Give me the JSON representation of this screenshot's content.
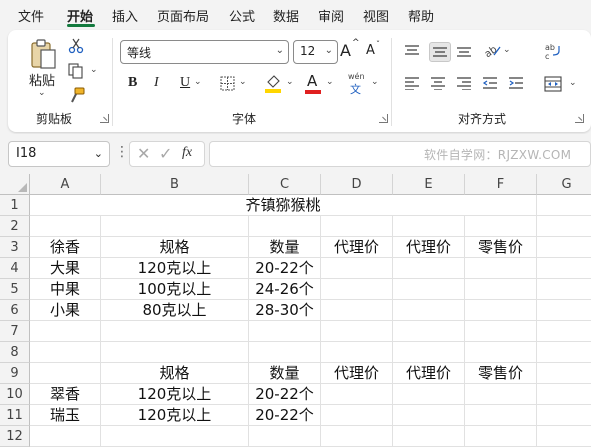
{
  "menu": {
    "tabs": [
      {
        "label": "文件"
      },
      {
        "label": "开始"
      },
      {
        "label": "插入"
      },
      {
        "label": "页面布局"
      },
      {
        "label": "公式"
      },
      {
        "label": "数据"
      },
      {
        "label": "审阅"
      },
      {
        "label": "视图"
      },
      {
        "label": "帮助"
      }
    ],
    "active_tab": "开始"
  },
  "ribbon": {
    "clipboard": {
      "label": "剪贴板",
      "paste_label": "粘贴"
    },
    "font": {
      "label": "字体",
      "font_name": "等线",
      "font_size": "12",
      "bold": "B",
      "italic": "I",
      "underline": "U",
      "grow_font": "A",
      "shrink_font": "A",
      "font_color_glyph": "A",
      "phonetic_top": "wén",
      "phonetic_bottom": "文"
    },
    "alignment": {
      "label": "对齐方式"
    }
  },
  "formula_bar": {
    "name_box": "I18",
    "fx_label": "fx",
    "formula_value": ""
  },
  "watermark": "软件自学网：RJZXW.COM",
  "grid": {
    "columns": [
      "A",
      "B",
      "C",
      "D",
      "E",
      "F",
      "G"
    ],
    "rows": [
      "1",
      "2",
      "3",
      "4",
      "5",
      "6",
      "7",
      "8",
      "9",
      "10",
      "11",
      "12"
    ],
    "cells": {
      "r1": {
        "title": "齐镇猕猴桃"
      },
      "r3": [
        "徐香",
        "规格",
        "数量",
        "代理价",
        "代理价",
        "零售价"
      ],
      "r4": [
        "大果",
        "120克以上",
        "20-22个",
        "",
        "",
        ""
      ],
      "r5": [
        "中果",
        "100克以上",
        "24-26个",
        "",
        "",
        ""
      ],
      "r6": [
        "小果",
        "80克以上",
        "28-30个",
        "",
        "",
        ""
      ],
      "r9": [
        "",
        "规格",
        "数量",
        "代理价",
        "代理价",
        "零售价"
      ],
      "r10": [
        "翠香",
        "120克以上",
        "20-22个",
        "",
        "",
        ""
      ],
      "r11": [
        "瑞玉",
        "120克以上",
        "20-22个",
        "",
        "",
        ""
      ]
    }
  },
  "colors": {
    "accent": "#137a3e",
    "font_color": "#e02020",
    "highlight": "#ffd600"
  }
}
